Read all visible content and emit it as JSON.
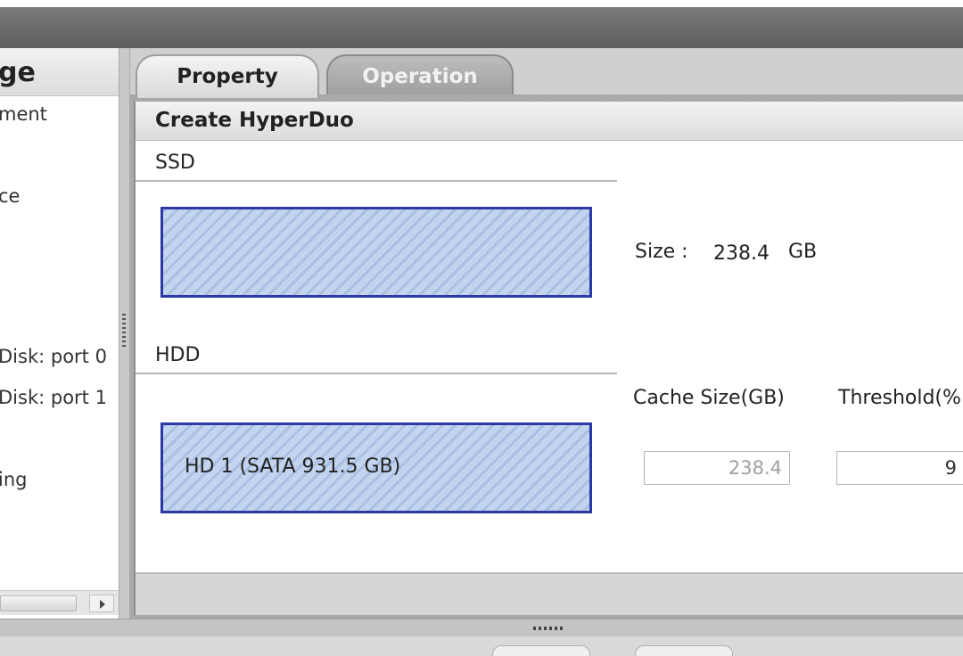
{
  "left_panel": {
    "title": "ge",
    "items": [
      "ment",
      "ce",
      "Disk: port 0",
      "Disk: port 1",
      "ing"
    ]
  },
  "tabs": [
    {
      "label": "Property",
      "active": true
    },
    {
      "label": "Operation",
      "active": false
    }
  ],
  "section": {
    "title": "Create HyperDuo"
  },
  "ssd": {
    "label": "SSD",
    "size_label": "Size :",
    "size_value": "238.4",
    "size_unit": "GB"
  },
  "hdd": {
    "label": "HDD",
    "disk_text": "HD 1 (SATA 931.5 GB)",
    "cache_size_label": "Cache Size(GB)",
    "cache_size_value": "238.4",
    "threshold_label": "Threshold(%",
    "threshold_value": "9"
  },
  "colors": {
    "disk_border": "#2b39a6",
    "disk_fill": "#b9cdea"
  }
}
